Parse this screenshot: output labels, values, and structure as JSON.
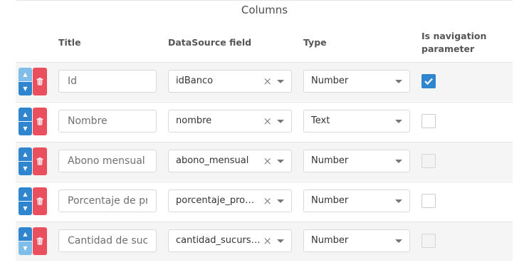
{
  "section": {
    "title": "Columns"
  },
  "headers": {
    "title": "Title",
    "datasource": "DataSource field",
    "type": "Type",
    "nav_line1": "Is navigation",
    "nav_line2": "parameter"
  },
  "icons": {
    "up": "arrow-up-icon",
    "down": "arrow-down-icon",
    "delete": "trash-icon",
    "clear": "clear-x-icon",
    "dropdown": "chevron-down-icon",
    "check": "checkmark-icon"
  },
  "colors": {
    "move_button": "#2f86cf",
    "move_button_disabled": "#80bde9",
    "delete_button": "#e94f5d",
    "checkbox_checked": "#2f86cf"
  },
  "clear_symbol": "×",
  "rows": [
    {
      "title": "Id",
      "datasource": "idBanco",
      "type": "Number",
      "nav_checked": true,
      "nav_disabled": false,
      "up_disabled": true,
      "down_disabled": false
    },
    {
      "title": "Nombre",
      "datasource": "nombre",
      "type": "Text",
      "nav_checked": false,
      "nav_disabled": false,
      "up_disabled": false,
      "down_disabled": false
    },
    {
      "title": "Abono mensual",
      "datasource": "abono_mensual",
      "type": "Number",
      "nav_checked": false,
      "nav_disabled": true,
      "up_disabled": false,
      "down_disabled": false
    },
    {
      "title": "Porcentaje de pro",
      "datasource": "porcentaje_prom...",
      "type": "Number",
      "nav_checked": false,
      "nav_disabled": false,
      "up_disabled": false,
      "down_disabled": false
    },
    {
      "title": "Cantidad de sucu",
      "datasource": "cantidad_sucursal...",
      "type": "Number",
      "nav_checked": false,
      "nav_disabled": true,
      "up_disabled": false,
      "down_disabled": true
    }
  ]
}
